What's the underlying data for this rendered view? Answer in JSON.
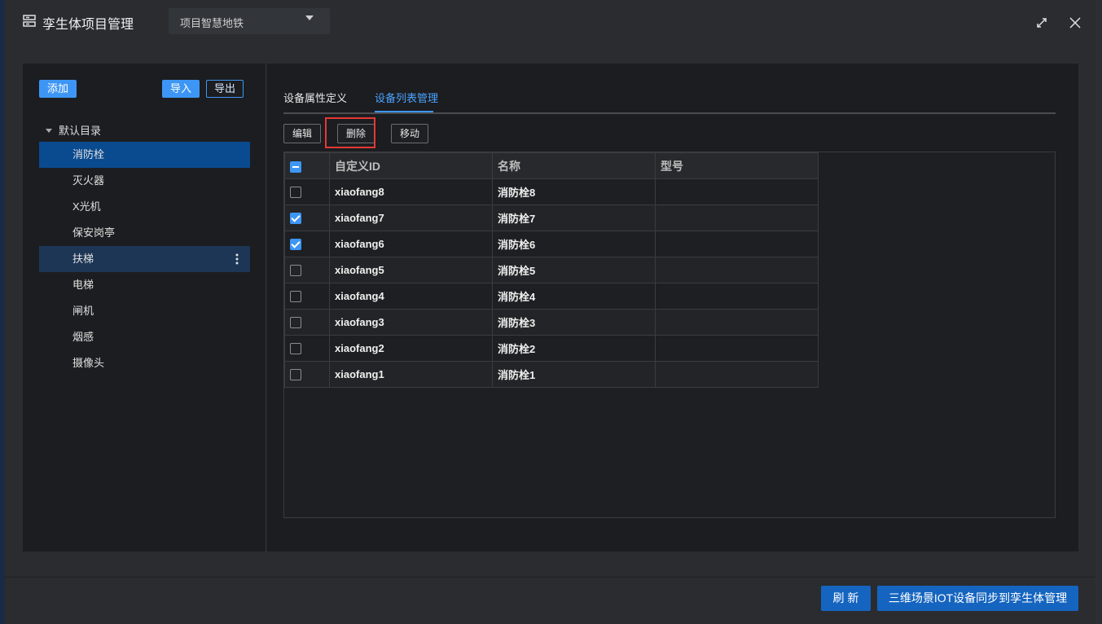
{
  "window": {
    "title": "孪生体项目管理",
    "project_select": "项目智慧地铁"
  },
  "sidebar": {
    "add_label": "添加",
    "import_label": "导入",
    "export_label": "导出",
    "root_label": "默认目录",
    "items": [
      {
        "label": "消防栓",
        "state": "selected"
      },
      {
        "label": "灭火器",
        "state": ""
      },
      {
        "label": "X光机",
        "state": ""
      },
      {
        "label": "保安岗亭",
        "state": ""
      },
      {
        "label": "扶梯",
        "state": "hover"
      },
      {
        "label": "电梯",
        "state": ""
      },
      {
        "label": "闸机",
        "state": ""
      },
      {
        "label": "烟感",
        "state": ""
      },
      {
        "label": "摄像头",
        "state": ""
      }
    ]
  },
  "tabs": [
    {
      "label": "设备属性定义",
      "active": false
    },
    {
      "label": "设备列表管理",
      "active": true
    }
  ],
  "toolbar": {
    "edit_label": "编辑",
    "delete_label": "删除",
    "move_label": "移动"
  },
  "table": {
    "columns": [
      "自定义ID",
      "名称",
      "型号"
    ],
    "rows": [
      {
        "id": "xiaofang8",
        "name": "消防栓8",
        "model": "",
        "checked": false
      },
      {
        "id": "xiaofang7",
        "name": "消防栓7",
        "model": "",
        "checked": true
      },
      {
        "id": "xiaofang6",
        "name": "消防栓6",
        "model": "",
        "checked": true
      },
      {
        "id": "xiaofang5",
        "name": "消防栓5",
        "model": "",
        "checked": false
      },
      {
        "id": "xiaofang4",
        "name": "消防栓4",
        "model": "",
        "checked": false
      },
      {
        "id": "xiaofang3",
        "name": "消防栓3",
        "model": "",
        "checked": false
      },
      {
        "id": "xiaofang2",
        "name": "消防栓2",
        "model": "",
        "checked": false
      },
      {
        "id": "xiaofang1",
        "name": "消防栓1",
        "model": "",
        "checked": false
      }
    ]
  },
  "footer": {
    "refresh_label": "刷 新",
    "sync_label": "三维场景IOT设备同步到孪生体管理"
  },
  "colors": {
    "accent": "#3d96f5",
    "selected_bg": "#0a4b8f",
    "highlight": "#e53935",
    "primary_button": "#1565c0"
  }
}
